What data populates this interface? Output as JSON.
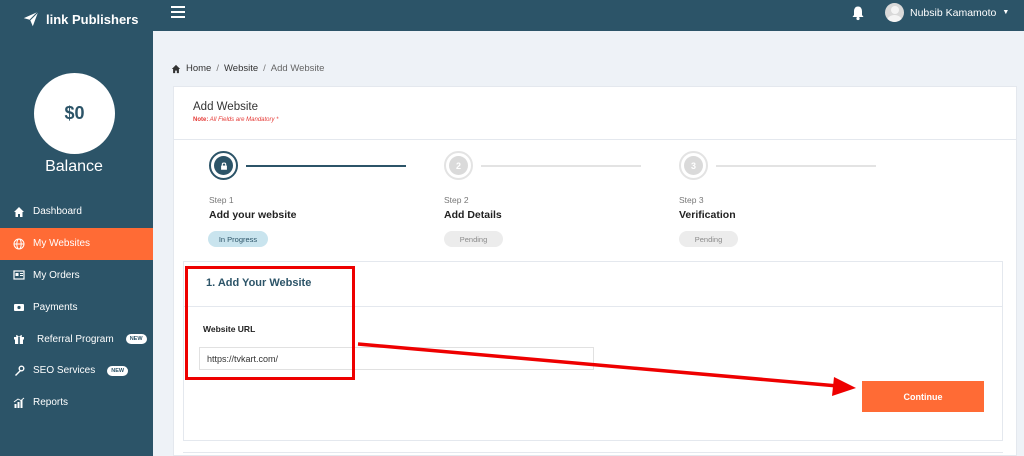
{
  "brand": {
    "name": "link Publishers"
  },
  "sidebar": {
    "balance_amount": "$0",
    "balance_label": "Balance",
    "items": [
      {
        "label": "Dashboard",
        "icon": "home-icon",
        "active": false
      },
      {
        "label": "My Websites",
        "icon": "globe-icon",
        "active": true
      },
      {
        "label": "My Orders",
        "icon": "orders-icon",
        "active": false
      },
      {
        "label": "Payments",
        "icon": "payments-icon",
        "active": false
      },
      {
        "label": "Referral Program",
        "icon": "gift-icon",
        "active": false,
        "badge": "NEW"
      },
      {
        "label": "SEO Services",
        "icon": "tools-icon",
        "active": false,
        "badge": "NEW"
      },
      {
        "label": "Reports",
        "icon": "chart-icon",
        "active": false
      }
    ]
  },
  "topbar": {
    "user_name": "Nubsib Kamamoto"
  },
  "breadcrumb": {
    "home": "Home",
    "section": "Website",
    "current": "Add Website",
    "separator": "/"
  },
  "card": {
    "title": "Add Website",
    "note_label": "Note:",
    "note_text": "All Fields are Mandatory *"
  },
  "steps": [
    {
      "number": "1",
      "label": "Step 1",
      "title": "Add your website",
      "status": "In Progress"
    },
    {
      "number": "2",
      "label": "Step 2",
      "title": "Add Details",
      "status": "Pending"
    },
    {
      "number": "3",
      "label": "Step 3",
      "title": "Verification",
      "status": "Pending"
    }
  ],
  "form": {
    "section_title": "1. Add Your Website",
    "url_label": "Website URL",
    "url_value": "https://tvkart.com/",
    "continue_label": "Continue"
  },
  "colors": {
    "sidebar": "#2c5468",
    "accent": "#ff6b35",
    "annotation": "#ee0000"
  }
}
